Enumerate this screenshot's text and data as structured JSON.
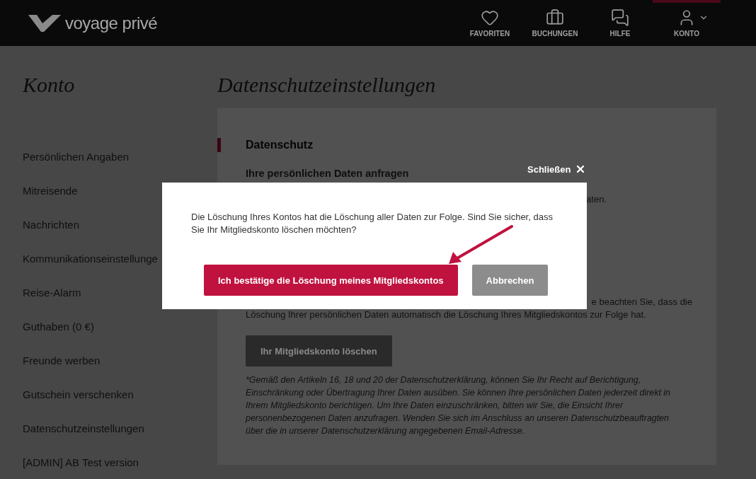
{
  "header": {
    "logo": "voyage privé",
    "nav": [
      {
        "label": "FAVORITEN",
        "selected": false
      },
      {
        "label": "BUCHUNGEN",
        "selected": false
      },
      {
        "label": "HILFE",
        "selected": false
      },
      {
        "label": "KONTO",
        "selected": true
      }
    ]
  },
  "sidebar": {
    "title": "Konto",
    "items": [
      "Persönlichen Angaben",
      "Mitreisende",
      "Nachrichten",
      "Kommunikationseinstellunge",
      "Reise-Alarm",
      "Guthaben (0 €)",
      "Freunde werben",
      "Gutschein verschenken",
      "Datenschutzeinstellungen",
      "[ADMIN] AB Test version"
    ]
  },
  "main": {
    "title": "Datenschutzeinstellungen",
    "section_title": "Datenschutz",
    "subheading": "Ihre persönlichen Daten anfragen",
    "fragment_1": "aten.",
    "fragment_2": "e beachten Sie, dass die",
    "paragraph_end": "Löschung Ihrer persönlichen Daten automatisch die Löschung Ihres Mitgliedskontos zur Folge hat.",
    "delete_button": "Ihr Mitgliedskonto löschen",
    "footnote": "*Gemäß den Artikeln 16, 18 und 20 der Datenschutzerklärung, können Sie Ihr Recht auf Berichtigung, Einschränkung oder Übertragung Ihrer Daten ausüben. Sie können Ihre persönlichen Daten jederzeit direkt in Ihrem Mitgliedskonto berichtigen. Um Ihre Daten einzuschränken, bitten wir Sie, die Einsicht Ihrer personenbezogenen Daten anzufragen. Wenden Sie sich im Anschluss an unseren Datenschutzbeauftragten über die in unserer Datenschutzerklärung angegebenen Email-Adresse."
  },
  "modal": {
    "close_label": "Schließen",
    "message": "Die Löschung Ihres Kontos hat die Löschung aller Daten zur Folge. Sind Sie sicher, dass Sie Ihr Mitgliedskonto löschen möchten?",
    "confirm_button": "Ich bestätige die Löschung meines Mitgliedskontos",
    "cancel_button": "Abbrechen"
  }
}
